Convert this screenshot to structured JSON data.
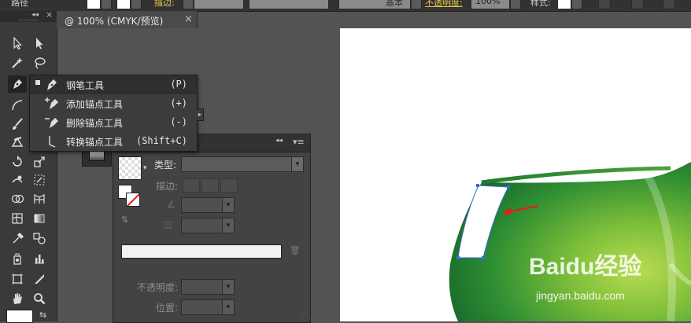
{
  "control_bar": {
    "path_label": "路径",
    "stroke_label": "描边:",
    "basic_label": "基本",
    "opacity_label": "不透明度:",
    "opacity_value": "100%",
    "style_label": "样式:"
  },
  "document": {
    "tab_title": "@ 100% (CMYK/预览)",
    "close_glyph": "×"
  },
  "tools": {
    "active": "pen-tool",
    "collapse_glyph": "◂◂",
    "close_glyph": "×"
  },
  "flyout": {
    "items": [
      {
        "label": "钢笔工具",
        "shortcut": "(P)",
        "selected": true
      },
      {
        "label": "添加锚点工具",
        "shortcut": "(+)",
        "selected": false
      },
      {
        "label": "删除锚点工具",
        "shortcut": "(-)",
        "selected": false
      },
      {
        "label": "转换锚点工具",
        "shortcut": "(Shift+C)",
        "selected": false
      }
    ],
    "more_glyph": "▸"
  },
  "graphic_panel": {
    "collapse_glyph": "◂◂",
    "menu_glyph": "▾≡",
    "type_label": "类型:",
    "stroke_label": "描边:",
    "opacity_label": "不透明度:",
    "position_label": "位置:",
    "dropdown_glyph": "▾",
    "delete_glyph": "🗑"
  },
  "watermark": {
    "logo": "Baidu经验",
    "url": "jingyan.baidu.com"
  },
  "colors": {
    "artwork_light_green": "#8cc63f",
    "artwork_dark_green": "#1e7d32",
    "annotation_arrow": "#e0201b",
    "path_outline": "#3a6bd8"
  }
}
